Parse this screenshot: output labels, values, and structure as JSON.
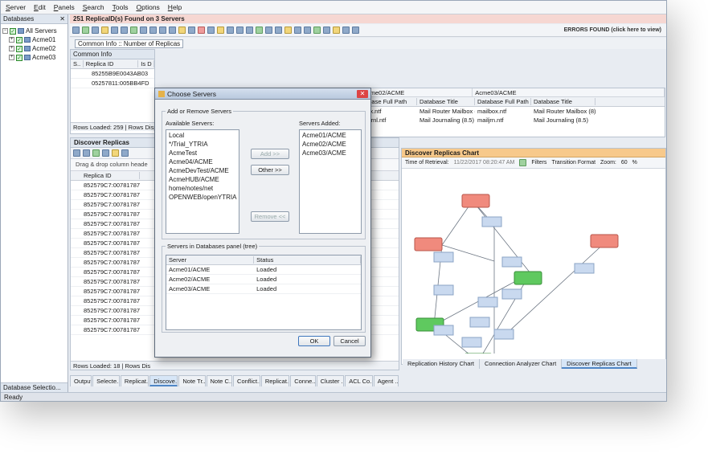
{
  "menu": [
    "Server",
    "Edit",
    "Panels",
    "Search",
    "Tools",
    "Options",
    "Help"
  ],
  "left": {
    "title": "Databases",
    "tree": [
      {
        "label": "All Servers",
        "level": 0
      },
      {
        "label": "Acme01",
        "level": 1
      },
      {
        "label": "Acme02",
        "level": 1
      },
      {
        "label": "Acme03",
        "level": 1
      }
    ],
    "bottom_label": "Database Selectio..."
  },
  "banner": "251 ReplicaID(s) Found on 3 Servers",
  "errors": "ERRORS FOUND (click here to view)",
  "common_info": {
    "combo": "Common Info :: Number of Replicas",
    "title": "Common Info",
    "headers": [
      "S..",
      "Replica ID",
      "Is D"
    ],
    "rows": [
      "85255B9E0043AB03",
      "05257811:005BB4FD"
    ],
    "status": "Rows Loaded: 259 | Rows Displ"
  },
  "right_grid": {
    "group_headers": [
      "Acme02/ACME",
      "Acme03/ACME"
    ],
    "headers": [
      "tabase Full Path",
      "Database Title",
      "Database Full Path",
      "Database Title"
    ],
    "rows": [
      [
        "box.ntf",
        "Mail Router Mailbox (8)",
        "mailbox.ntf",
        "Mail Router Mailbox (8)"
      ],
      [
        "mljrnl.ntf",
        "Mail Journaling (8.5)",
        "mailjrn.ntf",
        "Mail Journaling (8.5)"
      ]
    ]
  },
  "discover": {
    "title": "Discover Replicas",
    "drag_hint": "Drag & drop column heade",
    "column": "Replica ID",
    "rows": [
      "852579C7:00781787",
      "852579C7:00781787",
      "852579C7:00781787",
      "852579C7:00781787",
      "852579C7:00781787",
      "852579C7:00781787",
      "852579C7:00781787",
      "852579C7:00781787",
      "852579C7:00781787",
      "852579C7:00781787",
      "852579C7:00781787",
      "852579C7:00781787",
      "852579C7:00781787",
      "852579C7:00781787",
      "852579C7:00781787",
      "852579C7:00781787"
    ],
    "status": "Rows Loaded: 18 | Rows Dis"
  },
  "chart": {
    "title": "Discover Replicas Chart",
    "time_label": "Time of Retrieval:",
    "time_value": "11/22/2017 08:20:47 AM",
    "filters": "Filters",
    "transition": "Transition Format",
    "zoom_label": "Zoom:",
    "zoom_value": "60",
    "zoom_unit": "%",
    "tabs": [
      "Replication History Chart",
      "Connection Analyzer Chart",
      "Discover Replicas Chart"
    ],
    "active_tab": 2,
    "colors": {
      "red": "#f08a7d",
      "green": "#5fc95f",
      "blue": "#c9d9ef"
    }
  },
  "bottom_tabs": [
    "Output",
    "Selecte...",
    "Replicat...",
    "Discove...",
    "Note Tr...",
    "Note C...",
    "Conflict...",
    "Replicat...",
    "Conne...",
    "Cluster ...",
    "ACL Co...",
    "Agent ..."
  ],
  "bottom_active": 3,
  "statusbar": "Ready",
  "dialog": {
    "title": "Choose Servers",
    "group1": "Add or Remove Servers",
    "available_label": "Available Servers:",
    "available": [
      "Local",
      "*/Trial_YTRIA",
      "AcmeTest",
      "Acme04/ACME",
      "AcmeDevTest/ACME",
      "AcmeHUB/ACME",
      "home/notes/net",
      "OPENWEB/openYTRIA"
    ],
    "added_label": "Servers Added:",
    "added": [
      "Acme01/ACME",
      "Acme02/ACME",
      "Acme03/ACME"
    ],
    "add_btn": "Add >>",
    "other_btn": "Other >>",
    "remove_btn": "Remove <<",
    "group2": "Servers in Databases panel (tree)",
    "col_server": "Server",
    "col_status": "Status",
    "tree_servers": [
      {
        "server": "Acme01/ACME",
        "status": "Loaded"
      },
      {
        "server": "Acme02/ACME",
        "status": "Loaded"
      },
      {
        "server": "Acme03/ACME",
        "status": "Loaded"
      }
    ],
    "ok": "OK",
    "cancel": "Cancel"
  }
}
